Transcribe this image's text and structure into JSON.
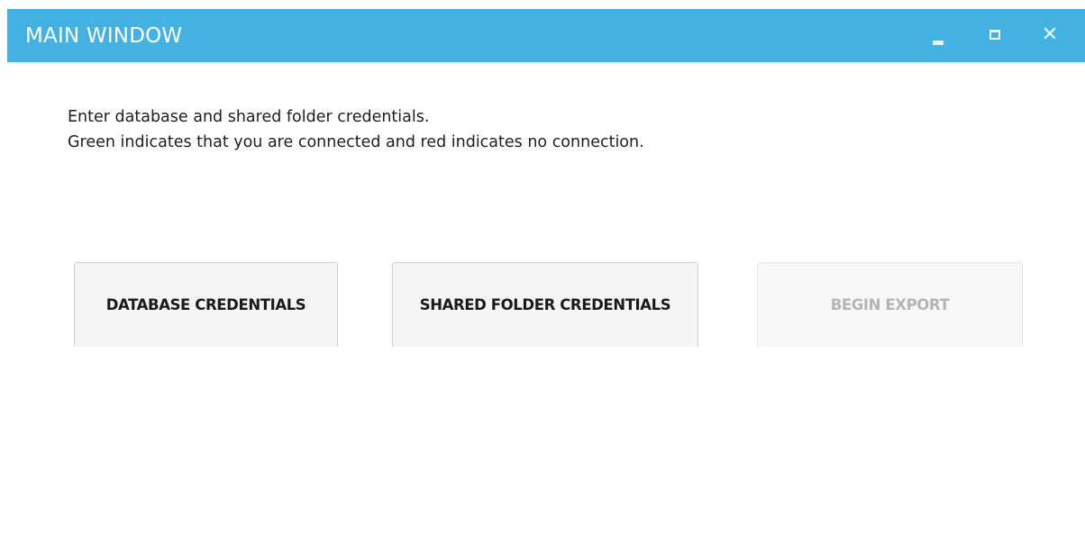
{
  "window": {
    "title": "MAIN WINDOW",
    "controls": {
      "minimize_icon": "minimize-icon",
      "maximize_icon": "maximize-icon",
      "close_icon": "close-icon",
      "close_glyph": "✕"
    }
  },
  "instructions": {
    "line1": "Enter database and shared folder credentials.",
    "line2": "Green indicates that you are connected and red indicates no connection."
  },
  "buttons": {
    "database": {
      "label": "DATABASE CREDENTIALS",
      "enabled": true
    },
    "shared_folder": {
      "label": "SHARED FOLDER CREDENTIALS",
      "enabled": true
    },
    "export": {
      "label": "BEGIN EXPORT",
      "enabled": false
    }
  },
  "colors": {
    "titlebar": "#43b1e1",
    "title_text": "#ffffff",
    "button_bg": "#f5f5f5",
    "disabled_text": "#b5b5b5"
  }
}
